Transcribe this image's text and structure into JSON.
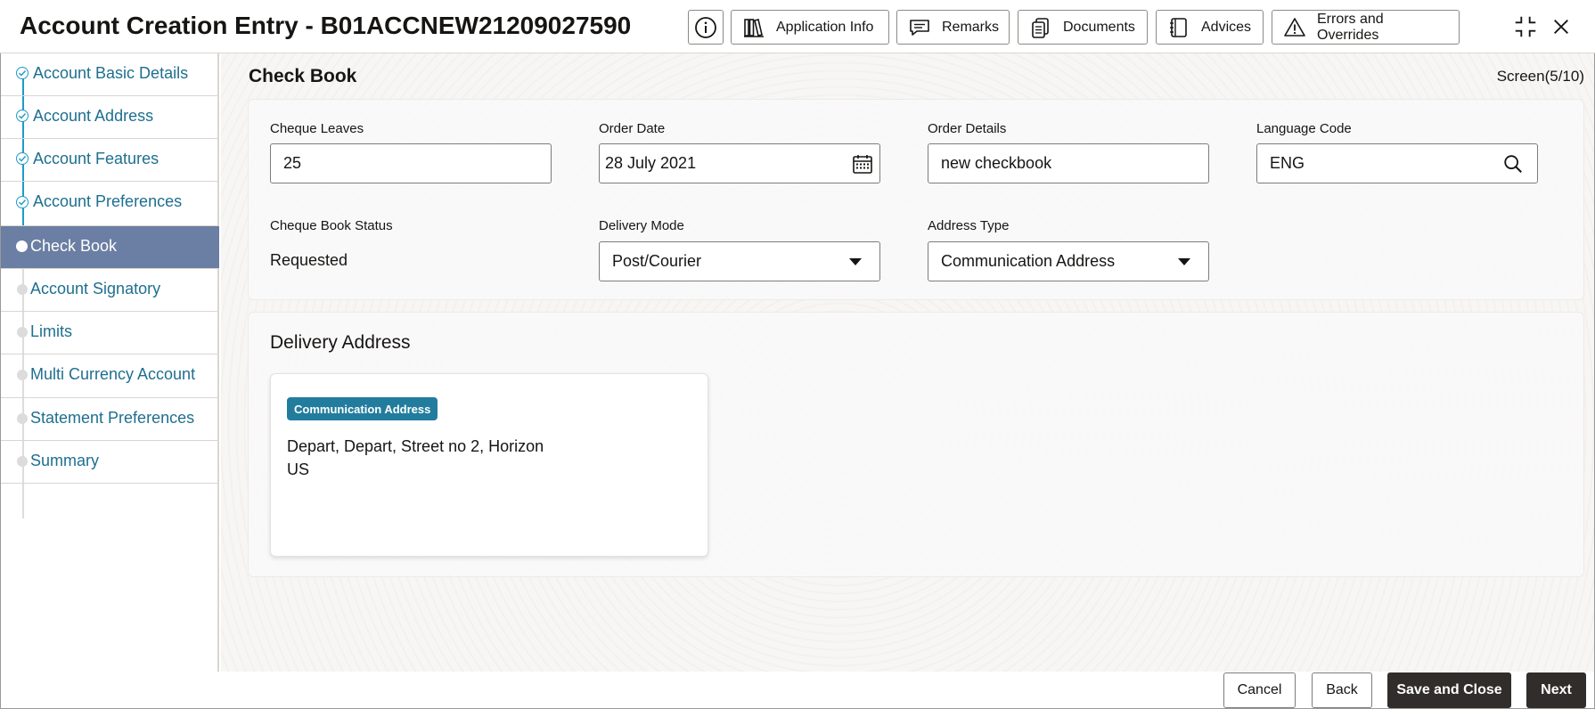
{
  "header": {
    "title": "Account Creation Entry - B01ACCNEW21209027590",
    "buttons": {
      "application_info": "Application Info",
      "remarks": "Remarks",
      "documents": "Documents",
      "advices": "Advices",
      "errors_overrides": "Errors and Overrides"
    },
    "icons": [
      "info-icon",
      "library-icon",
      "chat-bubble-icon",
      "documents-icon",
      "notebook-icon",
      "warning-icon",
      "collapse-icon",
      "close-icon"
    ]
  },
  "sidebar": {
    "items": [
      {
        "label": "Account Basic Details",
        "state": "done"
      },
      {
        "label": "Account Address",
        "state": "done"
      },
      {
        "label": "Account Features",
        "state": "done"
      },
      {
        "label": "Account Preferences",
        "state": "done"
      },
      {
        "label": "Check Book",
        "state": "current"
      },
      {
        "label": "Account Signatory",
        "state": "pending"
      },
      {
        "label": "Limits",
        "state": "pending"
      },
      {
        "label": "Multi Currency Account",
        "state": "pending"
      },
      {
        "label": "Statement Preferences",
        "state": "pending"
      },
      {
        "label": "Summary",
        "state": "pending"
      }
    ]
  },
  "main": {
    "section_title": "Check Book",
    "screen_counter": "Screen(5/10)",
    "fields": {
      "cheque_leaves": {
        "label": "Cheque Leaves",
        "value": "25"
      },
      "order_date": {
        "label": "Order Date",
        "value": "28 July 2021"
      },
      "order_details": {
        "label": "Order Details",
        "value": "new checkbook"
      },
      "language_code": {
        "label": "Language Code",
        "value": "ENG"
      },
      "cheque_book_status": {
        "label": "Cheque Book Status",
        "value": "Requested"
      },
      "delivery_mode": {
        "label": "Delivery Mode",
        "value": "Post/Courier"
      },
      "address_type": {
        "label": "Address Type",
        "value": "Communication Address"
      }
    },
    "delivery_address": {
      "heading": "Delivery Address",
      "card": {
        "badge": "Communication Address",
        "line1": "Depart, Depart, Street no 2, Horizon",
        "line2": "US"
      }
    }
  },
  "footer": {
    "cancel": "Cancel",
    "back": "Back",
    "save_close": "Save and Close",
    "next": "Next"
  },
  "colors": {
    "accent_link": "#1e6f8f",
    "active_nav": "#6b7ea3",
    "progress_line": "#1e9ac8",
    "badge": "#227c9d",
    "primary_button": "#312d2a"
  }
}
